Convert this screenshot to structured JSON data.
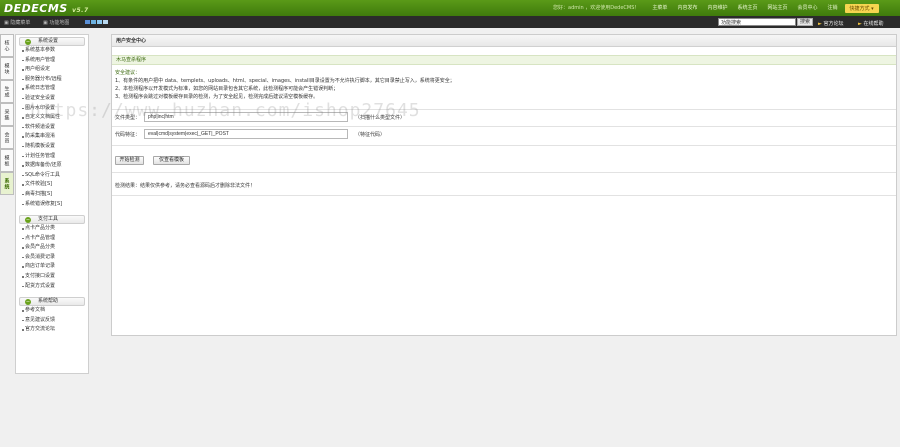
{
  "header": {
    "logo": "DEDECMS",
    "version": "v5.7",
    "welcome": "您好：admin ，欢迎使用DedeCMS！",
    "nav": [
      "主菜单",
      "内容发布",
      "内容维护",
      "系统主页",
      "网站主页",
      "会员中心",
      "注销"
    ],
    "shortcut": "快捷方式 ▾"
  },
  "subbar": {
    "mode_a": "隐藏菜单",
    "mode_b": "功能地图",
    "skin_colors": [
      "#5a8fd6",
      "#6cb1e0",
      "#8bc8f0",
      "#b8d8ef"
    ],
    "search_value": "功能搜索",
    "search_btn": "搜索",
    "link_forum": "官方论坛",
    "link_help": "在线帮助"
  },
  "lefttabs": [
    "核心",
    "模块",
    "生成",
    "采集",
    "会员",
    "模板",
    "系统"
  ],
  "sidebar": {
    "group_system": "系统设置",
    "system_items": [
      "系统基本参数",
      "系统用户管理",
      "用户组设定",
      "服务器分布/远程",
      "系统日志管理",
      "验证安全设置",
      "图片水印设置",
      "自定义文档属性",
      "软件频道设置",
      "防采集串混淆",
      "随机模板设置",
      "计划任务管理",
      "数据库备份/还原",
      "SQL命令行工具",
      "文件校验[S]",
      "病毒扫描[S]",
      "系统错误修复[S]"
    ],
    "group_pay": "支付工具",
    "pay_items": [
      "点卡产品分类",
      "点卡产品管理",
      "会员产品分类",
      "会员消费记录",
      "商店订单记录",
      "支付接口设置",
      "配货方式设置"
    ],
    "group_help": "系统帮助",
    "help_items": [
      "参考文档",
      "意见建议反馈",
      "官方交流论坛"
    ]
  },
  "main": {
    "title": "用户安全中心",
    "section": "木马查杀程序",
    "tips_title": "安全建议：",
    "tips": [
      "1、有条件的用户把中 data、templets、uploads、html、special、images、install目录设置为不允许执行脚本，其它目录禁止写入，系统将更安全；",
      "2、本检测程序以开发模式为标准，如您的网站目录包含其它系统，此检测程序可能会产生错误判断；",
      "3、检测程序会跳过对模板缓存目录的检测，为了安全起见，检测完成后建议清空模板缓存。"
    ],
    "file_type_label": "文件类型：",
    "file_type_value": "php|inc|htm",
    "file_type_note": "（扫描什么类型文件）",
    "code_label": "代码特征：",
    "code_value": "eval|cmd|system|exec|_GET|_POST",
    "code_note": "（特征代码）",
    "btn_scan": "开始检测",
    "btn_clear": "仅查看模板",
    "result_label": "检测结果：",
    "result_value": "结果仅供参考，请务必查看源码后才删除非法文件！"
  },
  "watermark": "https://www.huzhan.com/ishop27645"
}
